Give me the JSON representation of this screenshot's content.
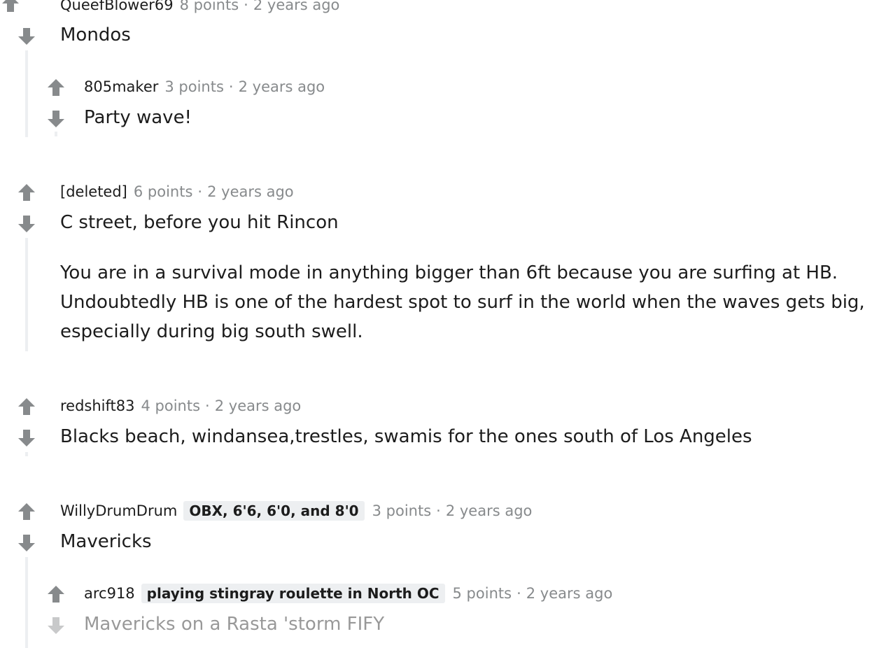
{
  "comments": [
    {
      "author": "QueefBlower69",
      "points": "8 points",
      "time": "2 years ago",
      "body": [
        "Mondos"
      ]
    },
    {
      "author": "805maker",
      "points": "3 points",
      "time": "2 years ago",
      "body": [
        "Party wave!"
      ]
    },
    {
      "author": "[deleted]",
      "points": "6 points",
      "time": "2 years ago",
      "body": [
        "C street, before you hit Rincon",
        "You are in a survival mode in anything bigger than 6ft because you are surfing at HB. Undoubtedly HB is one of the hardest spot to surf in the world when the waves gets big, especially during big south swell."
      ],
      "body_lines": [
        "You are in a survival mode in anything bigger than 6ft because you are surfing at HB.",
        "Undoubtedly HB is one of the hardest spot to surf in the world when the waves gets big,",
        "especially during big south swell."
      ]
    },
    {
      "author": "redshift83",
      "points": "4 points",
      "time": "2 years ago",
      "body": [
        "Blacks beach, windansea,trestles, swamis for the ones south of Los Angeles"
      ]
    },
    {
      "author": "WillyDrumDrum",
      "flair": "OBX, 6'6, 6'0, and 8'0",
      "points": "3 points",
      "time": "2 years ago",
      "body": [
        "Mavericks"
      ]
    },
    {
      "author": "arc918",
      "flair": "playing stingray roulette in North OC",
      "points": "5 points",
      "time": "2 years ago",
      "body": [
        "Mavericks on a Rasta 'storm FIFY"
      ]
    }
  ],
  "separator": "·",
  "icons": {
    "upvote": "upvote-arrow-icon",
    "downvote": "downvote-arrow-icon"
  },
  "colors": {
    "vote_arrow": "#878a8c",
    "meta_text": "#878a8c",
    "thread_line": "#edeff1",
    "flair_bg": "#edeff1"
  }
}
